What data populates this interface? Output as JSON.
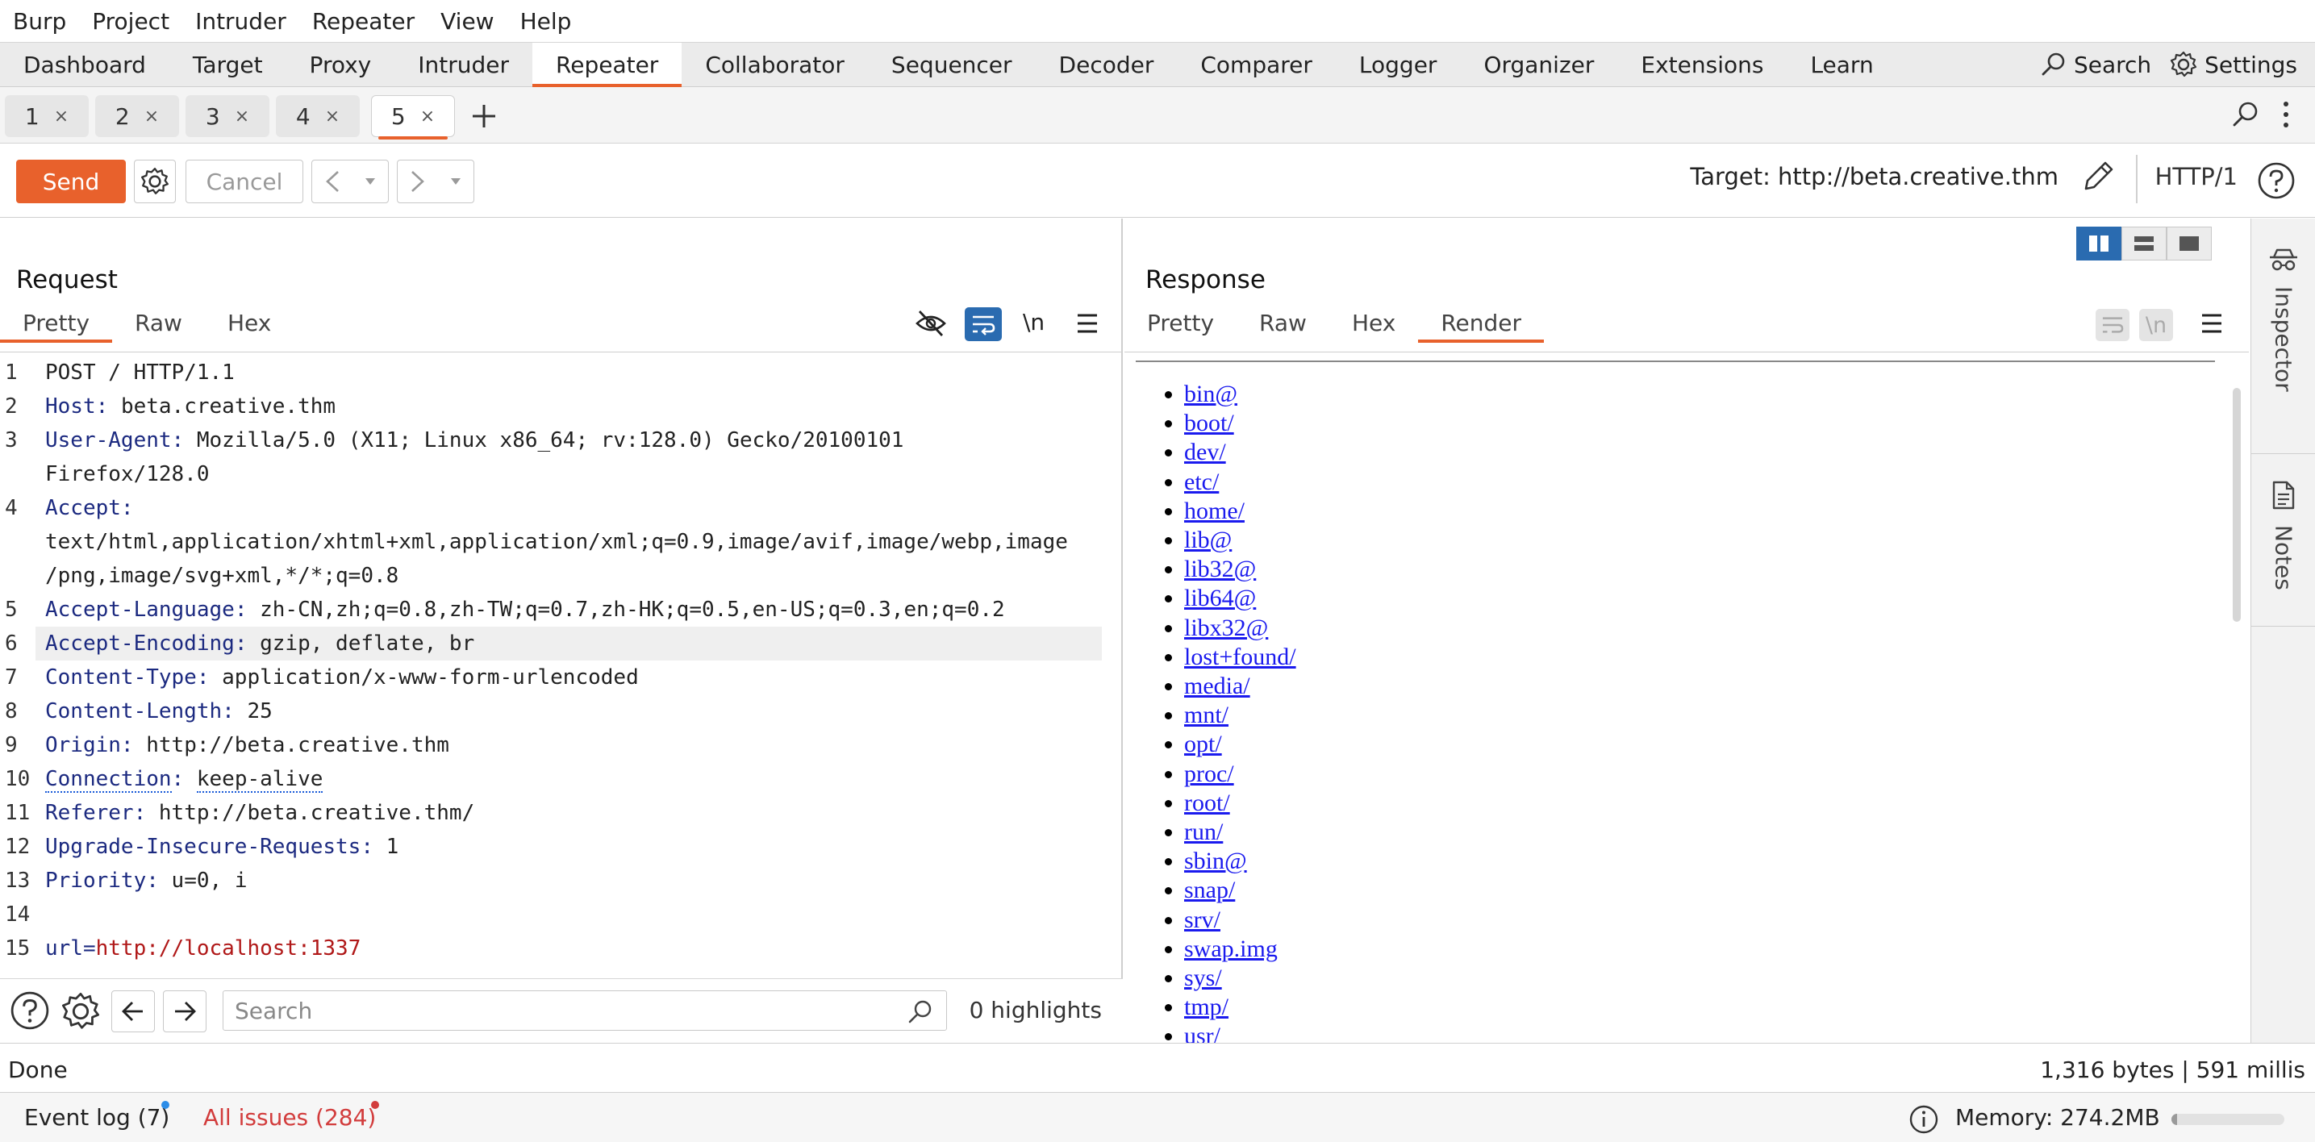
{
  "menu": [
    "Burp",
    "Project",
    "Intruder",
    "Repeater",
    "View",
    "Help"
  ],
  "tool_tabs": [
    "Dashboard",
    "Target",
    "Proxy",
    "Intruder",
    "Repeater",
    "Collaborator",
    "Sequencer",
    "Decoder",
    "Comparer",
    "Logger",
    "Organizer",
    "Extensions",
    "Learn"
  ],
  "active_tool_tab": "Repeater",
  "top_right": {
    "search_label": "Search",
    "settings_label": "Settings"
  },
  "repeater_tabs": [
    {
      "label": "1",
      "close": "×"
    },
    {
      "label": "2",
      "close": "×"
    },
    {
      "label": "3",
      "close": "×"
    },
    {
      "label": "4",
      "close": "×"
    },
    {
      "label": "5",
      "close": "×"
    }
  ],
  "active_repeater_tab": "5",
  "toolbar": {
    "send_label": "Send",
    "cancel_label": "Cancel",
    "target_text": "Target: http://beta.creative.thm",
    "http_version": "HTTP/1"
  },
  "request": {
    "title": "Request",
    "tabs": [
      "Pretty",
      "Raw",
      "Hex"
    ],
    "active_tab": "Pretty",
    "newline_label": "\\n",
    "lines": [
      {
        "n": "1",
        "key": "",
        "sep": "",
        "val": "POST / HTTP/1.1"
      },
      {
        "n": "2",
        "key": "Host",
        "sep": ": ",
        "val": "beta.creative.thm"
      },
      {
        "n": "3",
        "key": "User-Agent",
        "sep": ": ",
        "val": "Mozilla/5.0 (X11; Linux x86_64; rv:128.0) Gecko/20100101"
      },
      {
        "n": "",
        "key": "",
        "sep": "",
        "val": "Firefox/128.0"
      },
      {
        "n": "4",
        "key": "Accept",
        "sep": ":",
        "val": ""
      },
      {
        "n": "",
        "key": "",
        "sep": "",
        "val": "text/html,application/xhtml+xml,application/xml;q=0.9,image/avif,image/webp,image"
      },
      {
        "n": "",
        "key": "",
        "sep": "",
        "val": "/png,image/svg+xml,*/*;q=0.8"
      },
      {
        "n": "5",
        "key": "Accept-Language",
        "sep": ": ",
        "val": "zh-CN,zh;q=0.8,zh-TW;q=0.7,zh-HK;q=0.5,en-US;q=0.3,en;q=0.2"
      },
      {
        "n": "6",
        "key": "Accept-Encoding",
        "sep": ": ",
        "val": "gzip, deflate, br"
      },
      {
        "n": "7",
        "key": "Content-Type",
        "sep": ": ",
        "val": "application/x-www-form-urlencoded"
      },
      {
        "n": "8",
        "key": "Content-Length",
        "sep": ": ",
        "val": "25"
      },
      {
        "n": "9",
        "key": "Origin",
        "sep": ": ",
        "val": "http://beta.creative.thm"
      },
      {
        "n": "10",
        "key": "Connection",
        "sep": ": ",
        "val": "keep-alive"
      },
      {
        "n": "11",
        "key": "Referer",
        "sep": ": ",
        "val": "http://beta.creative.thm/"
      },
      {
        "n": "12",
        "key": "Upgrade-Insecure-Requests",
        "sep": ": ",
        "val": "1"
      },
      {
        "n": "13",
        "key": "Priority",
        "sep": ": ",
        "val": "u=0, i"
      },
      {
        "n": "14",
        "key": "",
        "sep": "",
        "val": ""
      },
      {
        "n": "15",
        "key": "url",
        "sep": "=",
        "val": "http://localhost:1337"
      }
    ],
    "search_placeholder": "Search",
    "highlights": "0 highlights"
  },
  "response": {
    "title": "Response",
    "tabs": [
      "Pretty",
      "Raw",
      "Hex",
      "Render"
    ],
    "active_tab": "Render",
    "newline_label": "\\n",
    "render_links": [
      "bin@",
      "boot/",
      "dev/",
      "etc/",
      "home/",
      "lib@",
      "lib32@",
      "lib64@",
      "libx32@",
      "lost+found/",
      "media/",
      "mnt/",
      "opt/",
      "proc/",
      "root/",
      "run/",
      "sbin@",
      "snap/",
      "srv/",
      "swap.img",
      "sys/",
      "tmp/",
      "usr/"
    ]
  },
  "sidebar": {
    "inspector_label": "Inspector",
    "notes_label": "Notes"
  },
  "status": {
    "left": "Done",
    "right": "1,316 bytes | 591 millis"
  },
  "bottom": {
    "event_log": "Event log (7)",
    "all_issues": "All issues (284)",
    "memory": "Memory: 274.2MB",
    "memory_fraction": 0.05
  },
  "colors": {
    "accent": "#e8612c",
    "link": "#1a1aee",
    "header_key": "#1c2a80",
    "param_value": "#b01818",
    "issues": "#d23c3c",
    "event_dot": "#2b8de8"
  }
}
